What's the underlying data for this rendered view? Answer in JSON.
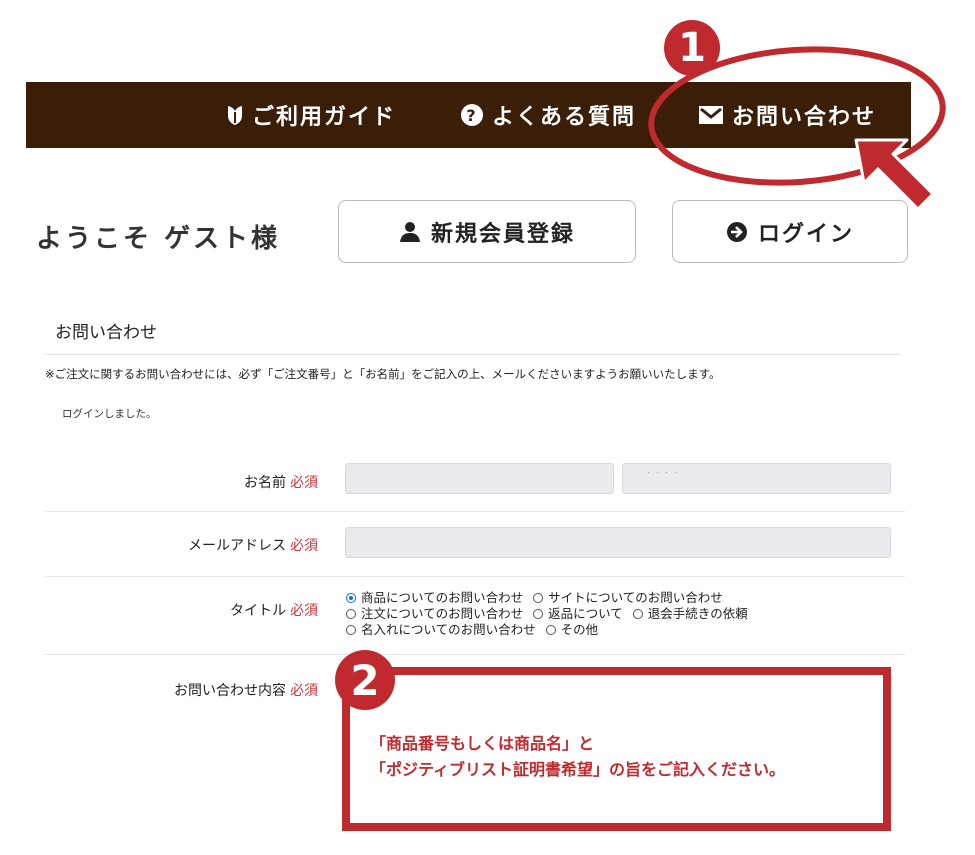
{
  "nav": {
    "guide": "ご利用ガイド",
    "faq": "よくある質問",
    "contact": "お問い合わせ"
  },
  "welcome": "ようこそ ゲスト様",
  "buttons": {
    "register": "新規会員登録",
    "login": "ログイン"
  },
  "form": {
    "title": "お問い合わせ",
    "notice": "※ご注文に関するお問い合わせには、必ず「ご注文番号」と「お名前」をご記入の上、メールくださいますようお願いいたします。",
    "login_message": "ログインしました。",
    "required": "必須",
    "name_label": "お名前",
    "name_last_value": "",
    "name_first_value": ". . . .",
    "email_label": "メールアドレス",
    "email_value": "",
    "title_label": "タイトル",
    "title_options": [
      {
        "label": "商品についてのお問い合わせ",
        "checked": true
      },
      {
        "label": "サイトについてのお問い合わせ",
        "checked": false
      },
      {
        "label": "注文についてのお問い合わせ",
        "checked": false
      },
      {
        "label": "返品について",
        "checked": false
      },
      {
        "label": "退会手続きの依頼",
        "checked": false
      },
      {
        "label": "名入れについてのお問い合わせ",
        "checked": false
      },
      {
        "label": "その他",
        "checked": false
      }
    ],
    "content_label": "お問い合わせ内容"
  },
  "annotations": {
    "badge1": "1",
    "badge2": "2",
    "callout_line1": "「商品番号もしくは商品名」と",
    "callout_line2": "「ポジティブリスト証明書希望」の旨をご記入ください。"
  },
  "colors": {
    "nav_bg": "#3a1e08",
    "annotation_red": "#c02a2e",
    "required_red": "#d0333b",
    "input_bg": "#e9ebee"
  },
  "icons": {
    "guide": "shield-leaf-icon",
    "faq": "question-circle-icon",
    "contact": "envelope-icon",
    "register": "user-icon",
    "login": "arrow-circle-right-icon"
  }
}
